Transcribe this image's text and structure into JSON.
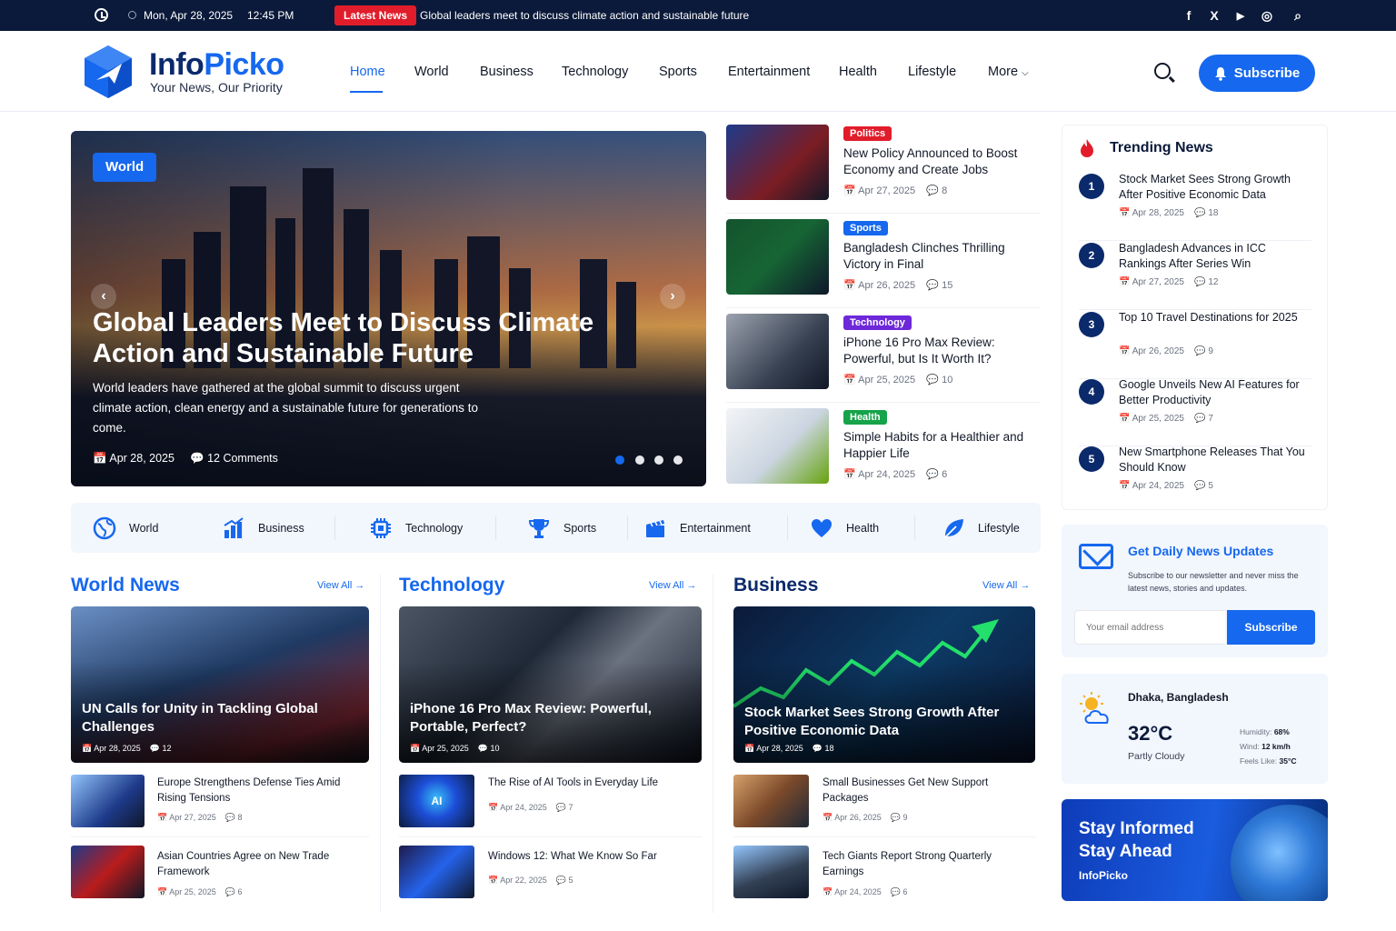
{
  "topbar": {
    "date": "Mon, Apr 28, 2025",
    "time": "12:45 PM",
    "latest_label": "Latest News",
    "ticker": "Global leaders meet to discuss climate action and sustainable future",
    "social": [
      "f",
      "X",
      "▶",
      "◎",
      "⌕"
    ]
  },
  "header": {
    "logo_part1": "Info",
    "logo_part2": "Picko",
    "tagline": "Your News, Our Priority",
    "nav": [
      "Home",
      "World",
      "Business",
      "Technology",
      "Sports",
      "Entertainment",
      "Health",
      "Lifestyle",
      "More"
    ],
    "subscribe": "Subscribe"
  },
  "hero": {
    "badge": "World",
    "title": "Global Leaders Meet to Discuss Climate Action and Sustainable Future",
    "desc": "World leaders have gathered at the global summit to discuss urgent climate action, clean energy and a sustainable future for generations to come.",
    "date": "Apr 28, 2025",
    "comments": "12 Comments"
  },
  "side_stories": [
    {
      "cat": "Politics",
      "color": "#e11d2b",
      "title": "New Policy Announced to Boost Economy and Create Jobs",
      "date": "Apr 27, 2025",
      "count": "8"
    },
    {
      "cat": "Sports",
      "color": "#1668ee",
      "title": "Bangladesh Clinches Thrilling Victory in Final",
      "date": "Apr 26, 2025",
      "count": "15"
    },
    {
      "cat": "Technology",
      "color": "#6d28d9",
      "title": "iPhone 16 Pro Max Review: Powerful, but Is It Worth It?",
      "date": "Apr 25, 2025",
      "count": "10"
    },
    {
      "cat": "Health",
      "color": "#16a34a",
      "title": "Simple Habits for a Healthier and Happier Life",
      "date": "Apr 24, 2025",
      "count": "6"
    }
  ],
  "trending": {
    "title": "Trending News",
    "items": [
      {
        "n": "1",
        "title": "Stock Market Sees Strong Growth After Positive Economic Data",
        "date": "Apr 28, 2025",
        "count": "18"
      },
      {
        "n": "2",
        "title": "Bangladesh Advances in ICC Rankings After Series Win",
        "date": "Apr 27, 2025",
        "count": "12"
      },
      {
        "n": "3",
        "title": "Top 10 Travel Destinations for 2025",
        "date": "Apr 26, 2025",
        "count": "9"
      },
      {
        "n": "4",
        "title": "Google Unveils New AI Features for Better Productivity",
        "date": "Apr 25, 2025",
        "count": "7"
      },
      {
        "n": "5",
        "title": "New Smartphone Releases That You Should Know",
        "date": "Apr 24, 2025",
        "count": "5"
      }
    ]
  },
  "categories": [
    "World",
    "Business",
    "Technology",
    "Sports",
    "Entertainment",
    "Health",
    "Lifestyle"
  ],
  "newsletter": {
    "title": "Get Daily News Updates",
    "text": "Subscribe to our newsletter and never miss the latest news, stories and updates.",
    "placeholder": "Your email address",
    "button": "Subscribe"
  },
  "weather": {
    "city": "Dhaka, Bangladesh",
    "temp": "32°C",
    "condition": "Partly Cloudy",
    "humidity_label": "Humidity:",
    "humidity": "68%",
    "wind_label": "Wind:",
    "wind": "12 km/h",
    "feels_label": "Feels Like:",
    "feels": "35°C"
  },
  "stay": {
    "title": "Stay Informed Stay Ahead",
    "brand": "InfoPicko"
  },
  "sections": [
    {
      "title": "World News",
      "title_color": "#1668ee",
      "view_all": "View All",
      "feature": {
        "title": "UN Calls for Unity in Tackling Global Challenges",
        "date": "Apr 28, 2025",
        "count": "12"
      },
      "items": [
        {
          "title": "Europe Strengthens Defense Ties Amid Rising Tensions",
          "date": "Apr 27, 2025",
          "count": "8"
        },
        {
          "title": "Asian Countries Agree on New Trade Framework",
          "date": "Apr 25, 2025",
          "count": "6"
        }
      ]
    },
    {
      "title": "Technology",
      "title_color": "#1668ee",
      "view_all": "View All",
      "feature": {
        "title": "iPhone 16 Pro Max Review: Powerful, Portable, Perfect?",
        "date": "Apr 25, 2025",
        "count": "10"
      },
      "items": [
        {
          "title": "The Rise of AI Tools in Everyday Life",
          "date": "Apr 24, 2025",
          "count": "7"
        },
        {
          "title": "Windows 12: What We Know So Far",
          "date": "Apr 22, 2025",
          "count": "5"
        }
      ]
    },
    {
      "title": "Business",
      "title_color": "#0b2a6b",
      "view_all": "View All",
      "feature": {
        "title": "Stock Market Sees Strong Growth After Positive Economic Data",
        "date": "Apr 28, 2025",
        "count": "18"
      },
      "items": [
        {
          "title": "Small Businesses Get New Support Packages",
          "date": "Apr 26, 2025",
          "count": "9"
        },
        {
          "title": "Tech Giants Report Strong Quarterly Earnings",
          "date": "Apr 24, 2025",
          "count": "6"
        }
      ]
    }
  ],
  "ai_label": "AI"
}
